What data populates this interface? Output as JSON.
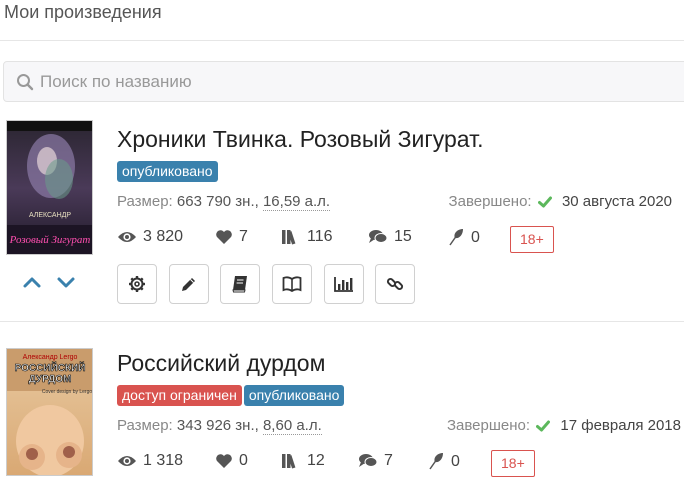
{
  "page": {
    "title": "Мои произведения"
  },
  "search": {
    "placeholder": "Поиск по названию"
  },
  "works": [
    {
      "title": "Хроники Твинка. Розовый Зигурат.",
      "badges": [
        {
          "label": "опубликовано",
          "color": "#3a81ad"
        }
      ],
      "size_label": "Размер:",
      "size_value": "663 790 зн.,",
      "size_al": "16,59 а.л.",
      "completed_label": "Завершено:",
      "completed_date": "30 августа 2020",
      "views": "3 820",
      "likes": "7",
      "libraries": "116",
      "comments": "15",
      "reviews": "0",
      "age": "18+"
    },
    {
      "title": "Российский дурдом",
      "badges": [
        {
          "label": "доступ ограничен",
          "color": "#d9534f"
        },
        {
          "label": "опубликовано",
          "color": "#3a81ad"
        }
      ],
      "size_label": "Размер:",
      "size_value": "343 926 зн.,",
      "size_al": "8,60 а.л.",
      "completed_label": "Завершено:",
      "completed_date": "17 февраля 2018",
      "views": "1 318",
      "likes": "0",
      "libraries": "12",
      "comments": "7",
      "reviews": "0",
      "age": "18+"
    }
  ],
  "cover_texts": {
    "w1": {
      "line1": "АЛЕКСАНДР",
      "line2": "Розовый Зигурат"
    },
    "w2": {
      "author": "Александр Lergo",
      "title1": "РОССИЙСКИЙ",
      "title2": "ДУРДОМ",
      "credit": "Cover design by Lergo"
    }
  },
  "icons": {
    "search": "search-icon",
    "eye": "eye-icon",
    "heart": "heart-icon",
    "library": "library-icon",
    "comments": "comments-icon",
    "feather": "feather-icon",
    "settings": "gear-icon",
    "edit": "pencil-icon",
    "book": "book-icon",
    "reader": "open-book-icon",
    "stats": "bar-chart-icon",
    "link": "link-icon",
    "up": "chevron-up-icon",
    "down": "chevron-down-icon",
    "check": "check-icon"
  },
  "colors": {
    "accent": "#3a81ad",
    "danger": "#d9534f",
    "success": "#5cb85c",
    "sort_arrows": "#3a81ad"
  }
}
